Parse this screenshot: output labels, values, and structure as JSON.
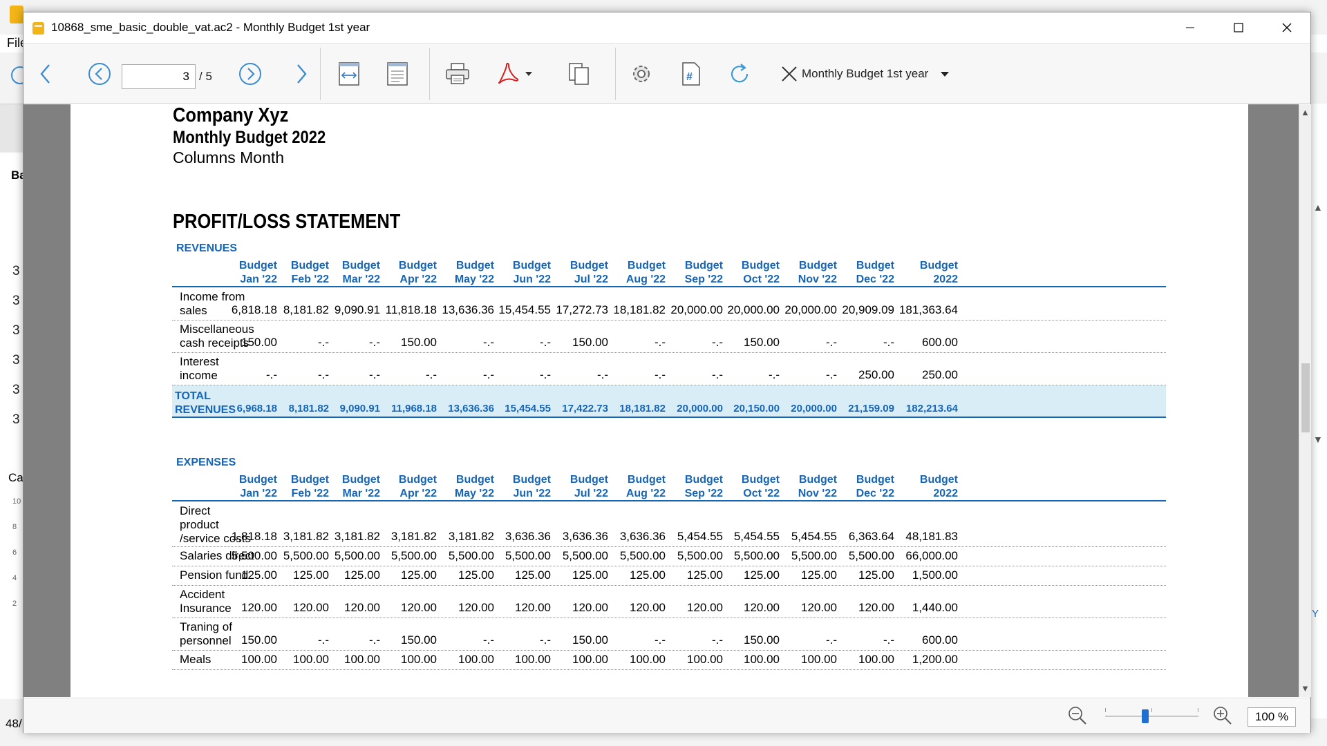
{
  "background": {
    "menu_file": "File",
    "panel_label": "Ba",
    "row_numbers": [
      "3",
      "3",
      "3",
      "3",
      "3",
      "3"
    ],
    "panel_label_2": "Ca",
    "chart_ticks": [
      "10",
      "8",
      "6",
      "4",
      "2"
    ],
    "bottom_text": "48/",
    "right_y": "Y"
  },
  "window": {
    "title": "10868_sme_basic_double_vat.ac2 - Monthly Budget 1st year"
  },
  "toolbar": {
    "page_current": "3",
    "page_total": "/ 5",
    "report_name": "Monthly Budget 1st year"
  },
  "report": {
    "company": "Company Xyz",
    "title": "Monthly Budget 2022",
    "subtitle": "Columns Month",
    "statement_title": "PROFIT/LOSS STATEMENT",
    "column_headers": [
      [
        "Budget",
        "Jan '22"
      ],
      [
        "Budget",
        "Feb '22"
      ],
      [
        "Budget",
        "Mar '22"
      ],
      [
        "Budget",
        "Apr '22"
      ],
      [
        "Budget",
        "May '22"
      ],
      [
        "Budget",
        "Jun '22"
      ],
      [
        "Budget",
        "Jul '22"
      ],
      [
        "Budget",
        "Aug '22"
      ],
      [
        "Budget",
        "Sep '22"
      ],
      [
        "Budget",
        "Oct '22"
      ],
      [
        "Budget",
        "Nov '22"
      ],
      [
        "Budget",
        "Dec '22"
      ],
      [
        "Budget",
        "2022"
      ]
    ],
    "revenues": {
      "label": "REVENUES",
      "rows": [
        {
          "label": [
            "Income from",
            "sales"
          ],
          "values": [
            "6,818.18",
            "8,181.82",
            "9,090.91",
            "11,818.18",
            "13,636.36",
            "15,454.55",
            "17,272.73",
            "18,181.82",
            "20,000.00",
            "20,000.00",
            "20,000.00",
            "20,909.09",
            "181,363.64"
          ]
        },
        {
          "label": [
            "Miscellaneous",
            "cash receipts"
          ],
          "values": [
            "150.00",
            "-.-",
            "-.-",
            "150.00",
            "-.-",
            "-.-",
            "150.00",
            "-.-",
            "-.-",
            "150.00",
            "-.-",
            "-.-",
            "600.00"
          ]
        },
        {
          "label": [
            "Interest",
            "income"
          ],
          "values": [
            "-.-",
            "-.-",
            "-.-",
            "-.-",
            "-.-",
            "-.-",
            "-.-",
            "-.-",
            "-.-",
            "-.-",
            "-.-",
            "250.00",
            "250.00"
          ]
        }
      ],
      "total_label": [
        "TOTAL",
        "REVENUES"
      ],
      "total_values": [
        "6,968.18",
        "8,181.82",
        "9,090.91",
        "11,968.18",
        "13,636.36",
        "15,454.55",
        "17,422.73",
        "18,181.82",
        "20,000.00",
        "20,150.00",
        "20,000.00",
        "21,159.09",
        "182,213.64"
      ]
    },
    "expenses": {
      "label": "EXPENSES",
      "rows": [
        {
          "label": [
            "Direct",
            "product",
            "/service costs"
          ],
          "values": [
            "1,818.18",
            "3,181.82",
            "3,181.82",
            "3,181.82",
            "3,181.82",
            "3,636.36",
            "3,636.36",
            "3,636.36",
            "5,454.55",
            "5,454.55",
            "5,454.55",
            "6,363.64",
            "48,181.83"
          ]
        },
        {
          "label": [
            "Salaries direct"
          ],
          "values": [
            "5,500.00",
            "5,500.00",
            "5,500.00",
            "5,500.00",
            "5,500.00",
            "5,500.00",
            "5,500.00",
            "5,500.00",
            "5,500.00",
            "5,500.00",
            "5,500.00",
            "5,500.00",
            "66,000.00"
          ]
        },
        {
          "label": [
            "Pension fund"
          ],
          "values": [
            "125.00",
            "125.00",
            "125.00",
            "125.00",
            "125.00",
            "125.00",
            "125.00",
            "125.00",
            "125.00",
            "125.00",
            "125.00",
            "125.00",
            "1,500.00"
          ]
        },
        {
          "label": [
            "Accident",
            "Insurance"
          ],
          "values": [
            "120.00",
            "120.00",
            "120.00",
            "120.00",
            "120.00",
            "120.00",
            "120.00",
            "120.00",
            "120.00",
            "120.00",
            "120.00",
            "120.00",
            "1,440.00"
          ]
        },
        {
          "label": [
            "Traning of",
            "personnel"
          ],
          "values": [
            "150.00",
            "-.-",
            "-.-",
            "150.00",
            "-.-",
            "-.-",
            "150.00",
            "-.-",
            "-.-",
            "150.00",
            "-.-",
            "-.-",
            "600.00"
          ]
        },
        {
          "label": [
            "Meals"
          ],
          "values": [
            "100.00",
            "100.00",
            "100.00",
            "100.00",
            "100.00",
            "100.00",
            "100.00",
            "100.00",
            "100.00",
            "100.00",
            "100.00",
            "100.00",
            "1,200.00"
          ]
        }
      ]
    }
  },
  "statusbar": {
    "zoom_value": "100 %",
    "zoom_level_percent": 100
  },
  "colors": {
    "accent_blue": "#1565b8",
    "total_band": "#d9edf7",
    "pdf_red": "#d21f1f",
    "nav_blue": "#1e6fd0"
  }
}
